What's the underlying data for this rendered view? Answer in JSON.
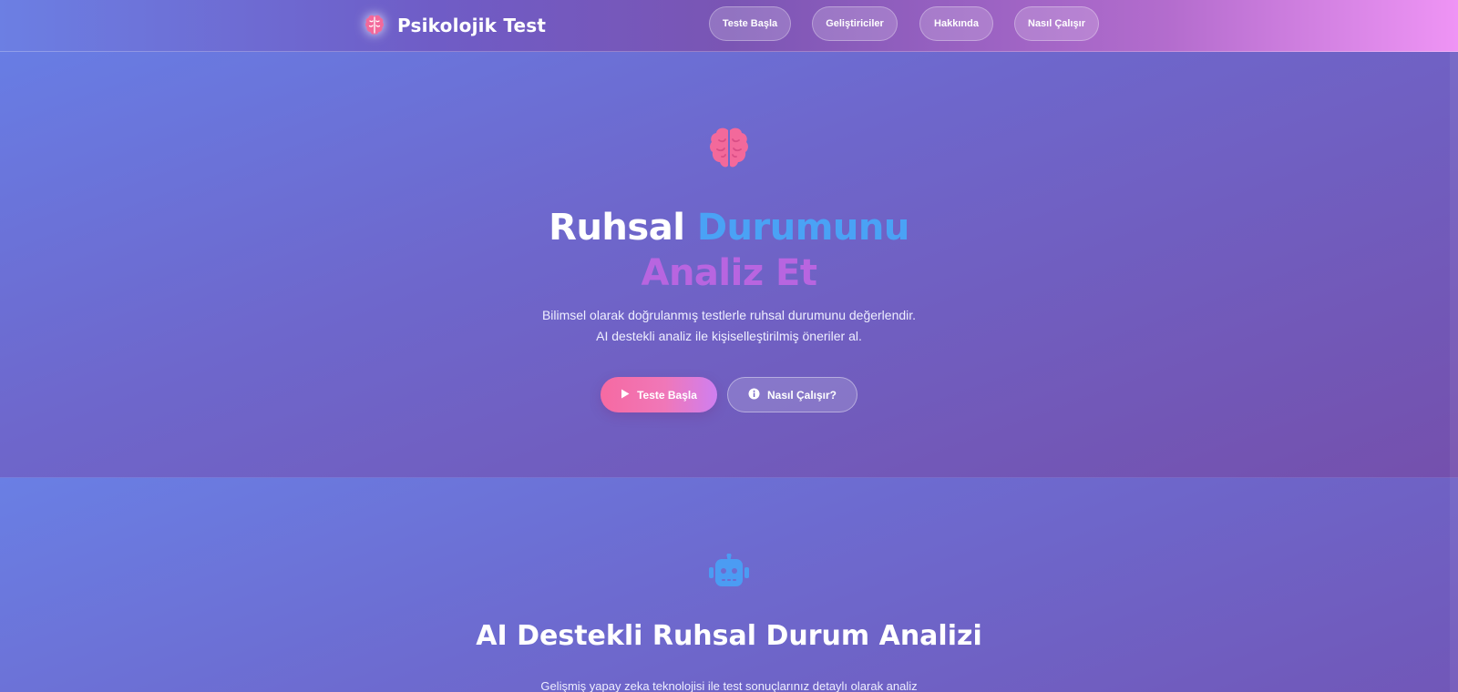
{
  "header": {
    "brand_title": "Psikolojik Test",
    "brand_icon": "brain-icon",
    "nav": [
      {
        "label": "Teste Başla"
      },
      {
        "label": "Geliştiriciler"
      },
      {
        "label": "Hakkında"
      },
      {
        "label": "Nasıl Çalışır"
      }
    ]
  },
  "hero": {
    "icon": "brain-icon",
    "title_part1": "Ruhsal",
    "title_part2": "Durumunu",
    "title_part3": "Analiz Et",
    "desc_line1": "Bilimsel olarak doğrulanmış testlerle ruhsal durumunu değerlendir.",
    "desc_line2": "AI destekli analiz ile kişiselleştirilmiş öneriler al.",
    "primary_button": {
      "label": "Teste Başla",
      "icon": "play-icon"
    },
    "secondary_button": {
      "label": "Nasıl Çalışır?",
      "icon": "info-icon"
    }
  },
  "ai_section": {
    "icon": "robot-icon",
    "title": "AI Destekli Ruhsal Durum Analizi",
    "desc": "Gelişmiş yapay zeka teknolojisi ile test sonuçlarınız detaylı olarak analiz"
  },
  "colors": {
    "accent_pink": "#f66aa2",
    "accent_blue": "#4aa2f5",
    "accent_purple": "#b865e0"
  }
}
